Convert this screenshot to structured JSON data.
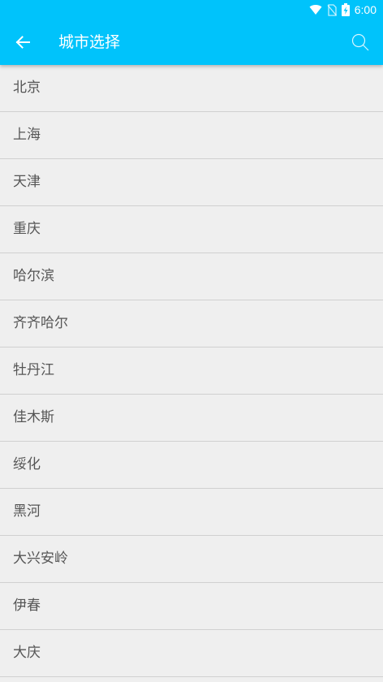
{
  "status_bar": {
    "time": "6:00",
    "icons": [
      "wifi-icon",
      "no-sim-icon",
      "battery-charging-icon"
    ]
  },
  "toolbar": {
    "back_icon": "arrow-left-icon",
    "title": "城市选择",
    "search_icon": "search-icon",
    "background": "#00c3fb"
  },
  "cities": [
    "北京",
    "上海",
    "天津",
    "重庆",
    "哈尔滨",
    "齐齐哈尔",
    "牡丹江",
    "佳木斯",
    "绥化",
    "黑河",
    "大兴安岭",
    "伊春",
    "大庆"
  ]
}
